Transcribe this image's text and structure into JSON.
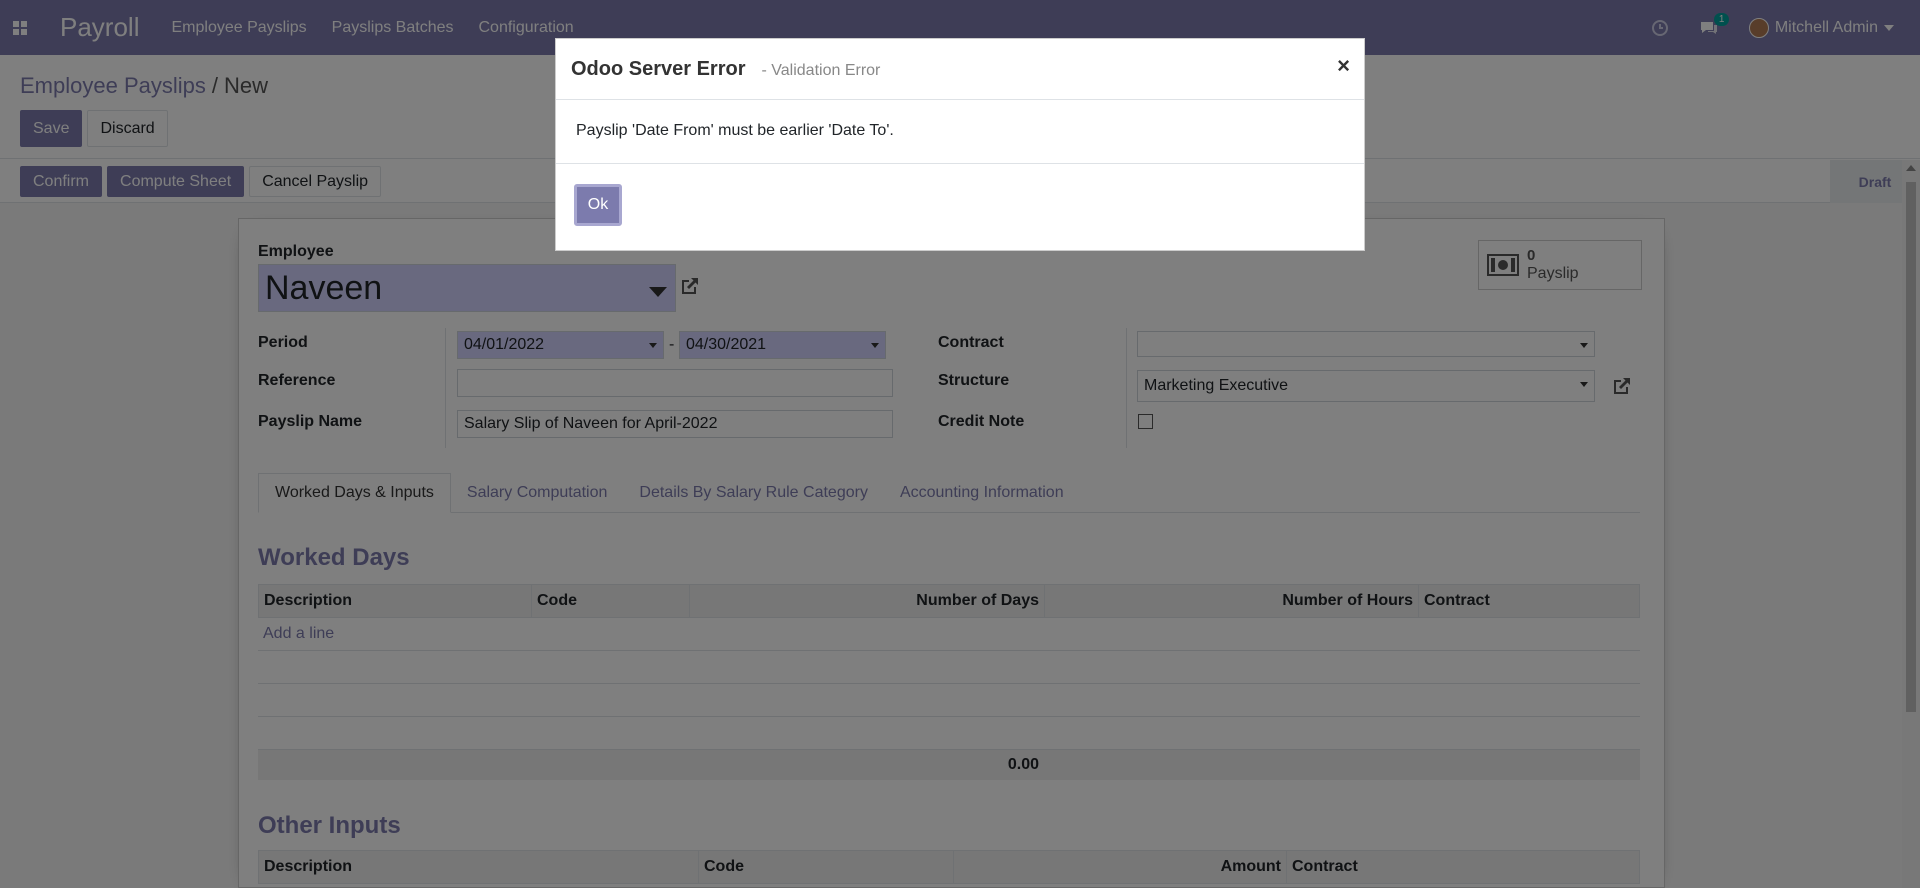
{
  "navbar": {
    "app_name": "Payroll",
    "menu": [
      "Employee Payslips",
      "Payslips Batches",
      "Configuration"
    ],
    "messages_badge": "1",
    "user_name": "Mitchell Admin"
  },
  "breadcrumb": {
    "parent": "Employee Payslips",
    "separator": "/",
    "current": "New"
  },
  "control": {
    "save": "Save",
    "discard": "Discard"
  },
  "statusbar": {
    "confirm": "Confirm",
    "compute": "Compute Sheet",
    "cancel": "Cancel Payslip",
    "state": "Draft"
  },
  "smart_button": {
    "count": "0",
    "label": "Payslip"
  },
  "form": {
    "employee_label": "Employee",
    "employee": "Naveen",
    "period_label": "Period",
    "date_from": "04/01/2022",
    "date_sep": "-",
    "date_to": "04/30/2021",
    "reference_label": "Reference",
    "reference": "",
    "payslip_name_label": "Payslip Name",
    "payslip_name": "Salary Slip of Naveen for April-2022",
    "contract_label": "Contract",
    "contract": "",
    "structure_label": "Structure",
    "structure": "Marketing Executive",
    "credit_note_label": "Credit Note"
  },
  "tabs": [
    "Worked Days & Inputs",
    "Salary Computation",
    "Details By Salary Rule Category",
    "Accounting Information"
  ],
  "worked_days": {
    "title": "Worked Days",
    "columns": [
      "Description",
      "Code",
      "Number of Days",
      "Number of Hours",
      "Contract"
    ],
    "add_line": "Add a line",
    "total": "0.00"
  },
  "other_inputs": {
    "title": "Other Inputs",
    "columns": [
      "Description",
      "Code",
      "Amount",
      "Contract"
    ]
  },
  "modal": {
    "title": "Odoo Server Error",
    "subtitle": "- Validation Error",
    "close": "×",
    "message": "Payslip 'Date From' must be earlier 'Date To'.",
    "ok": "Ok"
  }
}
